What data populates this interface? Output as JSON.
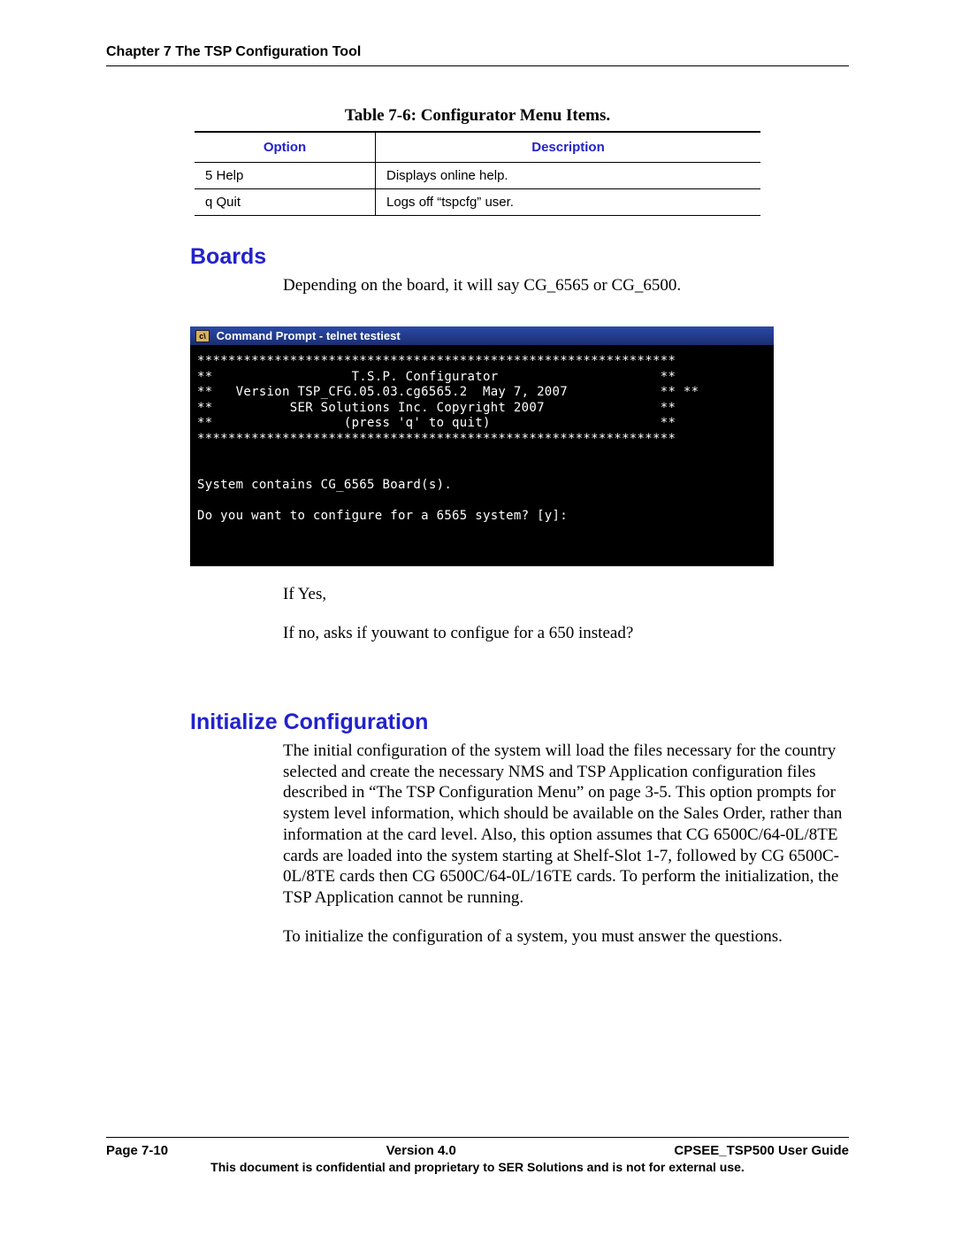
{
  "header": "Chapter 7 The TSP Configuration Tool",
  "table": {
    "caption": "Table 7-6: Configurator Menu Items.",
    "col1": "Option",
    "col2": "Description",
    "rows": [
      {
        "opt": "5  Help",
        "desc": "Displays online help."
      },
      {
        "opt": "q  Quit",
        "desc": "Logs off “tspcfg” user."
      }
    ]
  },
  "boards": {
    "heading": "Boards",
    "intro": "Depending on the board, it will say CG_6565 or CG_6500.",
    "terminal_title": "Command Prompt - telnet testiest",
    "terminal_body": "**************************************************************\n**                  T.S.P. Configurator                     **\n**   Version TSP_CFG.05.03.cg6565.2  May 7, 2007            ** **\n**          SER Solutions Inc. Copyright 2007               **\n**                 (press 'q' to quit)                      **\n**************************************************************\n\n\nSystem contains CG_6565 Board(s).\n\nDo you want to configure for a 6565 system? [y]:",
    "after1": "If Yes,",
    "after2": "If no,  asks if youwant to configue for a 650 instead?"
  },
  "initconf": {
    "heading": "Initialize Configuration",
    "p1": "The initial configuration of the system will load the files necessary for the country selected and create the necessary NMS and TSP Application configuration files described in “The TSP Configuration Menu” on page 3-5. This option prompts for system level information, which should be available on the Sales Order, rather than information at the card level. Also, this option assumes that CG 6500C/64-0L/8TE cards are loaded into the system starting at Shelf-Slot 1-7, followed by CG 6500C-0L/8TE cards then CG 6500C/64-0L/16TE cards. To perform the initialization, the TSP Application cannot be running.",
    "p2": "To initialize the configuration of a system, you must answer the questions."
  },
  "footer": {
    "page": "Page 7-10",
    "version": "Version 4.0",
    "guide": "CPSEE_TSP500 User Guide",
    "confidential": "This document is confidential and proprietary to SER Solutions and is not for external use."
  }
}
